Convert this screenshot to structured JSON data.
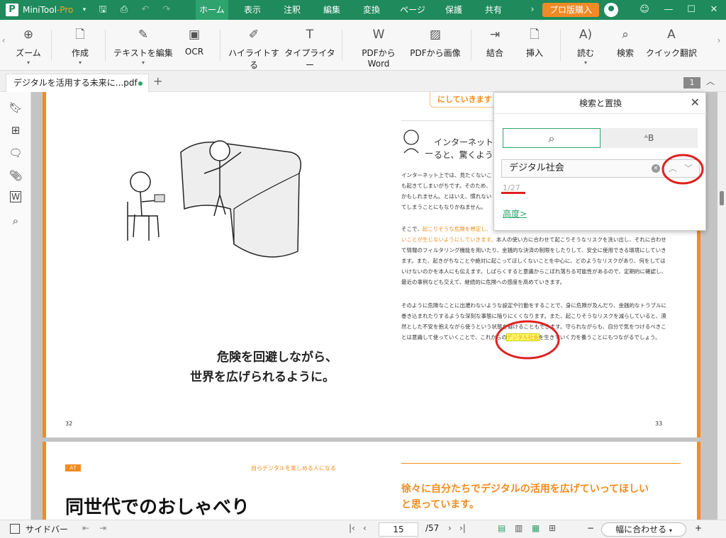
{
  "app": {
    "name": "MiniTool",
    "pro": "-Pro"
  },
  "menus": [
    "ホーム",
    "表示",
    "注釈",
    "編集",
    "変換",
    "ページ",
    "保護",
    "共有"
  ],
  "buy_label": "プロ版購入",
  "toolbar": {
    "zoom": "ズーム",
    "create": "作成",
    "edit_text": "テキストを編集",
    "ocr": "OCR",
    "highlight": "ハイライトする",
    "typewriter": "タイプライター",
    "pdf_to_word": "PDFからWord",
    "pdf_to_image": "PDFから画像",
    "merge": "結合",
    "insert": "挿入",
    "read": "読む",
    "search": "検索",
    "quick_translate": "クイック翻訳"
  },
  "tab": {
    "title": "デジタルを活用する未来に...pdf",
    "page_badge": "1"
  },
  "page1": {
    "top_banner": "にしていきます",
    "heading_line1": "インターネット上",
    "heading_line2": "ると、驚くような",
    "para1": [
      "インターネット上では、見たくないこ",
      "も起きてしまいがちです。そのため、",
      "かもしれません。とはいえ、慣れない",
      "てしまうことにもなりかねません。"
    ],
    "para2_orange_1": "起こりそうな危険を想定し、",
    "para2_orange_2": "いことが生じないようにしていきます。",
    "para2_lead": "そこで、",
    "para2": [
      "本人の使い方に合わせて起こりそうなリスクを洗い出し、それに合わせ",
      "て情報のフィルタリング機能を用いたり、金銭的な決済の制限をしたりして、安全に使用できる環境にしていき",
      "ます。また、起きがちなことや絶対に起こってほしくないことを中心に、どのようなリスクがあり、何をしては",
      "いけないのかを本人にも伝えます。しばらくすると意識からこぼれ落ちる可能性があるので、定期的に確認し、",
      "最近の事例なども交えて、継続的に危険への感度を高めていきます。"
    ],
    "para3": [
      "そのように危険なことに出遭わないような設定や行動をすることで、身に危険が及んだり、金銭的なトラブルに",
      "巻き込まれたりするような深刻な事態に陥りにくくなります。また、起こりそうなリスクを減らしていると、漠",
      "然とした不安を抱えながら使うという状態を避けることもできます。守られながらも、自分で気をつけるべきこ"
    ],
    "para3_last_a": "とは意識して使っていくことで、これからの",
    "para3_highlight": "デジタル社会",
    "para3_last_b": "を生きていく力を養うことにもつながるでしょう。",
    "caption_line1": "危険を回避しながら、",
    "caption_line2": "世界を広げられるように。",
    "page_left": "32",
    "page_right": "33"
  },
  "page2": {
    "badge": "A7",
    "running_head": "自らデジタルを楽しめる人になる",
    "title": "同世代でのおしゃべり",
    "heading_line1": "徐々に自分たちでデジタルの活用を広げていってほしい",
    "heading_line2": "と思っています。"
  },
  "search_panel": {
    "title": "検索と置換",
    "query": "デジタル社会",
    "count": "1/27",
    "advanced": "高度>"
  },
  "status": {
    "sidebar_label": "サイドバー",
    "page_current": "15",
    "page_total": "/57",
    "fit_label": "幅に合わせる"
  },
  "colors": {
    "accent": "#1f8a5b",
    "orange": "#f28c1e",
    "annotation": "#e02020",
    "highlight": "#ffff66"
  }
}
